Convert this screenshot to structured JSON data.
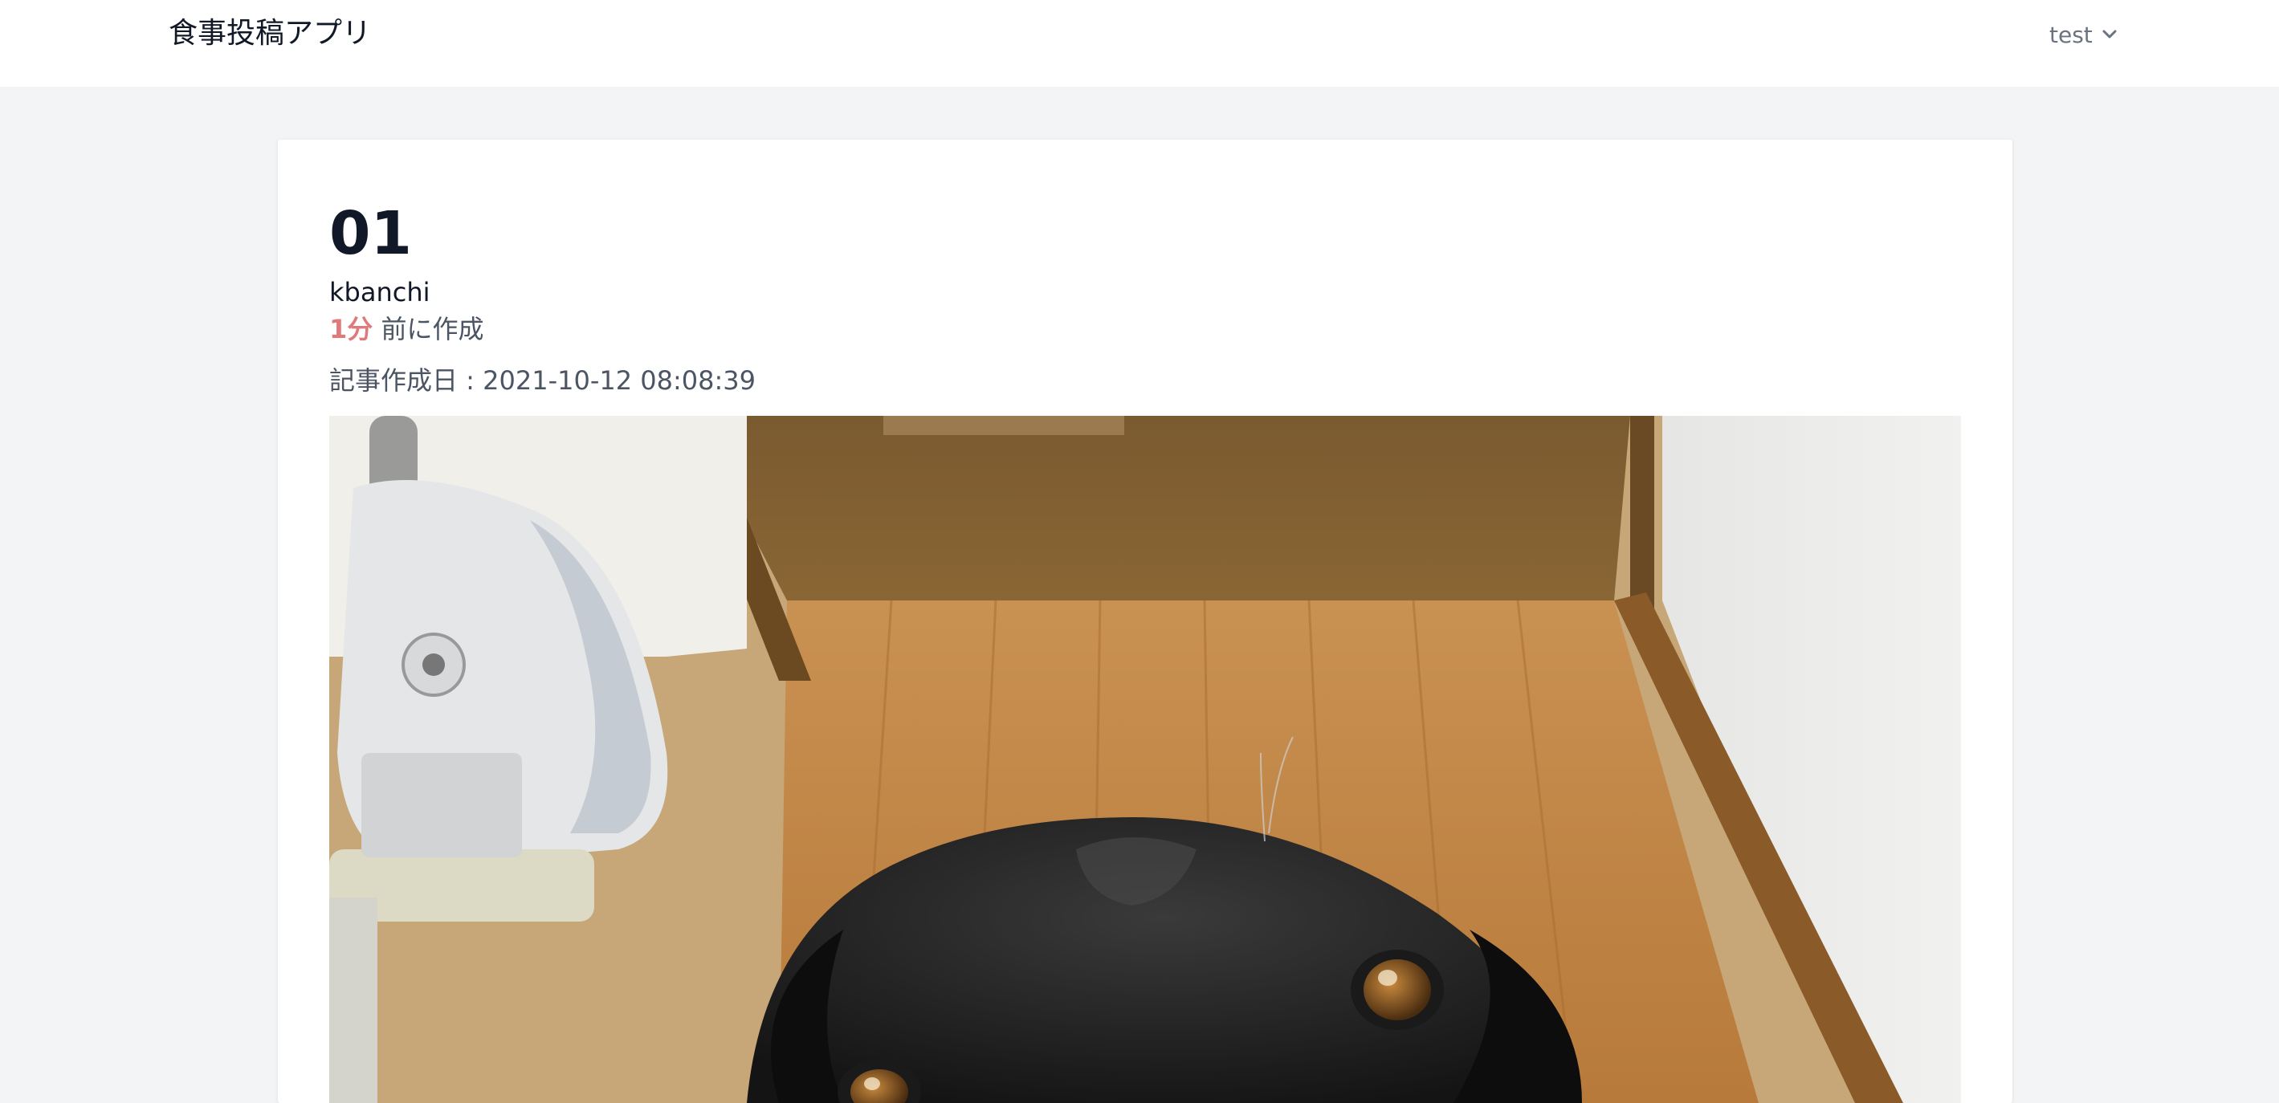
{
  "header": {
    "app_title": "食事投稿アプリ",
    "user_name": "test",
    "user_menu_icon": "chevron-down-icon"
  },
  "post": {
    "title": "01",
    "author": "kbanchi",
    "relative_time_value": "1分",
    "relative_time_suffix": " 前に作成",
    "created_label": "記事作成日 : ",
    "created_at": "2021-10-12 08:08:39",
    "image_alt": "photo of a black dog looking up at the camera",
    "accent_color": "#e07a7a"
  }
}
